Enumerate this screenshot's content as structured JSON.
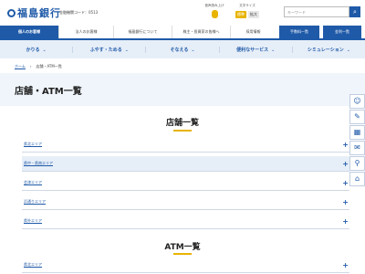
{
  "header": {
    "logo_text": "福島銀行",
    "bank_code": "金融機関コード：0513",
    "voice_label": "音声読み上げ",
    "size_label": "文字サイズ",
    "size_options": [
      "標準",
      "拡大"
    ],
    "search_placeholder": "キーワード",
    "search_icon": "search-icon"
  },
  "nav_primary": {
    "items": [
      "個人のお客様",
      "法人のお客様",
      "福島銀行について",
      "株主・投資家の皆様へ",
      "採用情報"
    ],
    "buttons": [
      "手数料一覧",
      "金利一覧"
    ]
  },
  "nav_secondary": {
    "items": [
      "かりる",
      "ふやす・ためる",
      "そなえる",
      "便利なサービス",
      "シミュレーション"
    ]
  },
  "breadcrumb": {
    "home": "ホーム",
    "current": "店舗・ATM一覧"
  },
  "page_title": "店舗・ATM一覧",
  "side_tools": [
    "person-icon",
    "note-icon",
    "calc-icon",
    "mail-icon",
    "pin-icon",
    "building-icon"
  ],
  "stores": {
    "title": "店舗一覧",
    "areas": [
      "県北エリア",
      "県中・県南エリア",
      "会津エリア",
      "浜通りエリア",
      "県外エリア"
    ]
  },
  "atm": {
    "title": "ATM一覧",
    "areas": [
      "県北エリア"
    ]
  },
  "colors": {
    "brand": "#1f5aa8",
    "accent": "#e8b400",
    "band": "#e6eef8"
  }
}
